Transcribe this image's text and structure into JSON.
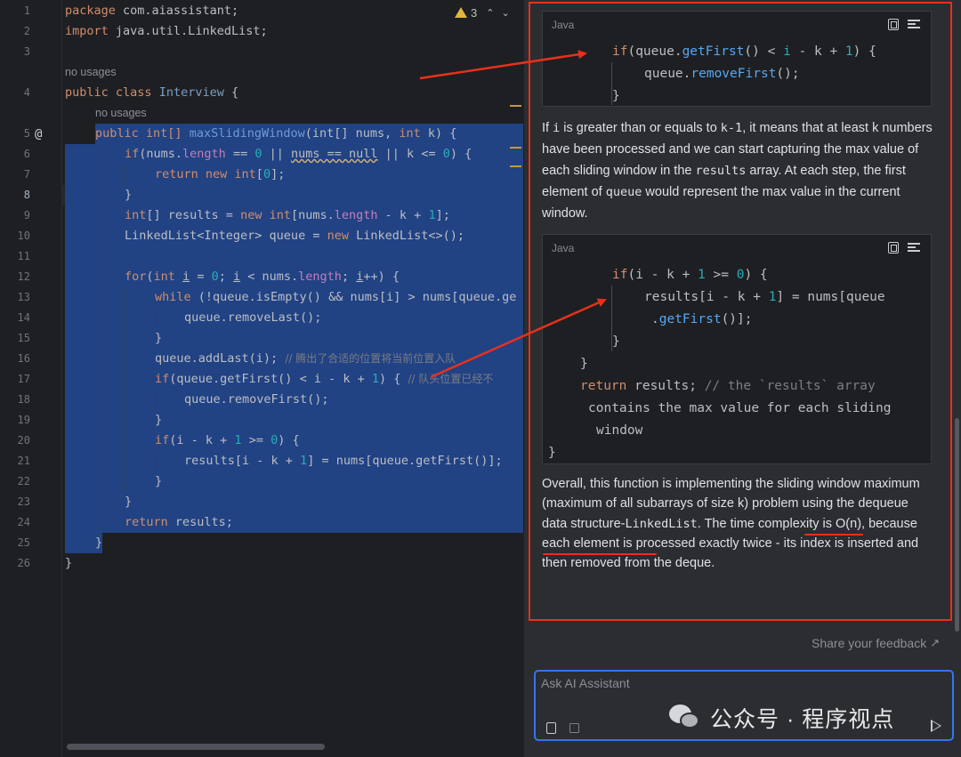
{
  "editor": {
    "line_numbers": [
      "1",
      "2",
      "3",
      "4",
      "5",
      "6",
      "7",
      "8",
      "9",
      "10",
      "11",
      "12",
      "13",
      "14",
      "15",
      "16",
      "17",
      "18",
      "19",
      "20",
      "21",
      "22",
      "23",
      "24",
      "25",
      "26"
    ],
    "current_line": "8",
    "warning_count": "3",
    "no_usages": "no usages",
    "code": {
      "l1_kw": "package",
      "l1_rest": " com.aiassistant;",
      "l2_kw": "import",
      "l2_rest": " java.util.LinkedList;",
      "l4_kw": "public class",
      "l4_name": "Interview",
      "l4_rest": " {",
      "l5_kw": "public",
      "l5_a": " int[] ",
      "l5_fn": "maxSlidingWindow",
      "l5_b": "(int[] nums, ",
      "l5_kw2": "int",
      "l5_c": " k) {",
      "l6": "if(nums.length == 0 || nums == null || k <= 0) {",
      "l7_kw": "return new",
      "l7_kw2": " int",
      "l7_a": "[",
      "l7_num": "0",
      "l7_b": "];",
      "l8": "}",
      "l9_a": "int[] results = ",
      "l9_kw": "new",
      "l9_b": " int[nums.",
      "l9_fd": "length",
      "l9_c": " - k + ",
      "l9_num": "1",
      "l9_d": "];",
      "l10_a": "LinkedList<Integer> queue = ",
      "l10_kw": "new",
      "l10_b": " LinkedList<>();",
      "l12_kw": "for",
      "l12_a": "(",
      "l12_kw2": "int",
      "l12_b": " i = ",
      "l12_num": "0",
      "l12_c": "; i < nums.",
      "l12_fd": "length",
      "l12_d": "; i++) {",
      "l13_kw": "while",
      "l13_a": " (!queue.isEmpty() && nums[i] > nums[queue.ge",
      "l14": "queue.removeLast();",
      "l15": "}",
      "l16_a": "queue.addLast(i); ",
      "l16_cm": "// 腾出了合适的位置将当前位置入队",
      "l17_kw": "if",
      "l17_a": "(queue.getFirst() < i - k + ",
      "l17_num": "1",
      "l17_b": ") { ",
      "l17_cm": "// 队头位置已经不",
      "l18": "queue.removeFirst();",
      "l19": "}",
      "l20_kw": "if",
      "l20_a": "(i - k + ",
      "l20_num": "1",
      "l20_b": " >= ",
      "l20_num2": "0",
      "l20_c": ") {",
      "l21_a": "results[i - k + ",
      "l21_num": "1",
      "l21_b": "] = nums[queue.getFirst()]; ",
      "l22": "}",
      "l23": "}",
      "l24_kw": "return",
      "l24_a": " results;",
      "l25": "}",
      "l26": "}"
    }
  },
  "assistant": {
    "code_lang": "Java",
    "block1": {
      "l1_kw": "if",
      "l1_a": "(queue.",
      "l1_fn": "getFirst",
      "l1_b": "() < ",
      "l1_i": "i",
      "l1_c": " - k + ",
      "l1_num": "1",
      "l1_d": ") {",
      "l2_a": "queue.",
      "l2_fn": "removeFirst",
      "l2_b": "();",
      "l3": "}"
    },
    "para1": {
      "t1": "If ",
      "c1": "i",
      "t2": " is greater than or equals to ",
      "c2": "k-1",
      "t3": ", it means that at least k numbers have been processed and we can start capturing the max value of each sliding window in the ",
      "c3": "results",
      "t4": " array. At each step, the first element of ",
      "c4": "queue",
      "t5": " would represent the max value in the current window."
    },
    "block2": {
      "l1_kw": "if",
      "l1_a": "(i - k + ",
      "l1_num": "1",
      "l1_b": " >= ",
      "l1_num2": "0",
      "l1_c": ") {",
      "l2_a": "results[i - k + ",
      "l2_num": "1",
      "l2_b": "] = nums[queue",
      "l3_a": ".",
      "l3_fn": "getFirst",
      "l3_b": "()];",
      "l4": "}",
      "l5": "}",
      "l6_kw": "return",
      "l6_a": " results; ",
      "l6_cm": "// the `results` array",
      "l7_cm": "contains the max value for each sliding",
      "l8_cm": "window",
      "l9": "}"
    },
    "para2": {
      "t1": "Overall, this function is implementing the sliding window maximum (maximum of all subarrays of size k) problem using the dequeue data structure-",
      "c1": "LinkedList",
      "t2": ". The time complexity is O(n), because each element is processed exactly twice - its index is inserted and then removed from the deque."
    },
    "feedback": "Share your feedback",
    "input_placeholder": "Ask AI Assistant",
    "watermark": "公众号 · 程序视点"
  },
  "colors": {
    "accent_blue": "#3574f0",
    "annotation_red": "#e8301c",
    "selection": "#214283",
    "keyword": "#cf8e6d",
    "method": "#56a8f5",
    "number": "#2aacb8"
  },
  "icons": [
    "warning-icon",
    "chevron-up-icon",
    "chevron-down-icon",
    "copy-icon",
    "insert-code-icon",
    "attach-icon",
    "save-icon",
    "send-icon",
    "external-link-icon",
    "wechat-icon"
  ]
}
